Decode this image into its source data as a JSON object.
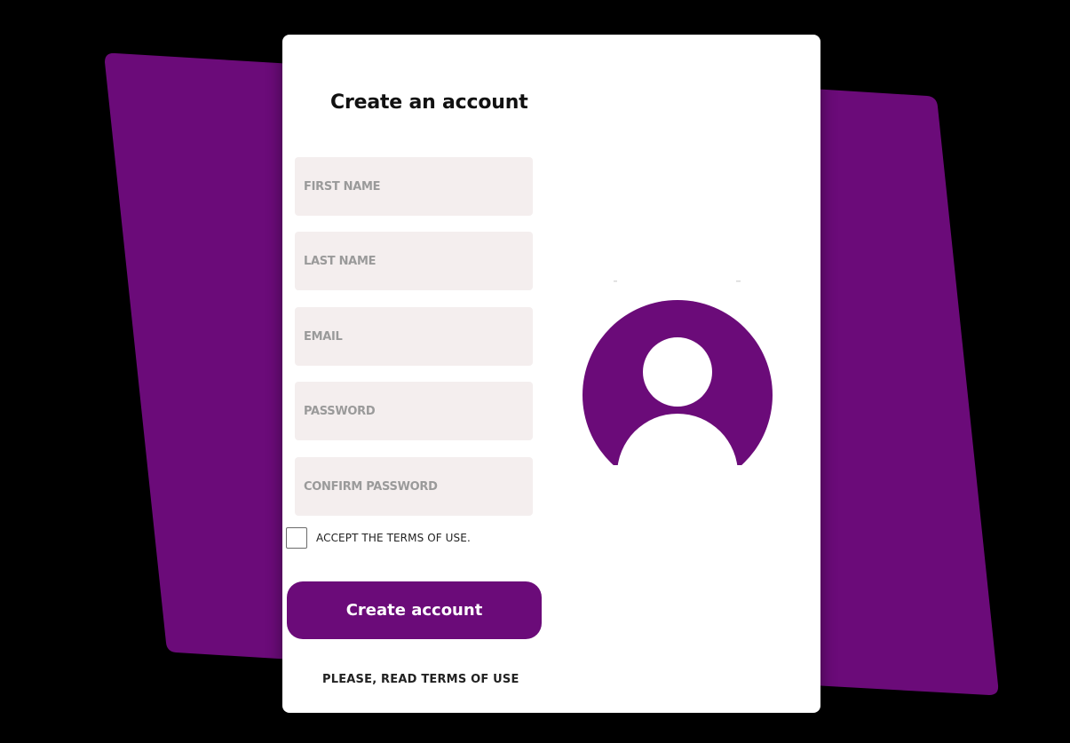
{
  "colors": {
    "background": "#000000",
    "accent": "#6b0b79",
    "card": "#ffffff",
    "field_bg": "#f4eeee",
    "placeholder": "#9a9a9a"
  },
  "form": {
    "title": "Create an account",
    "fields": [
      {
        "name": "first-name",
        "placeholder": "FIRST NAME",
        "value": ""
      },
      {
        "name": "last-name",
        "placeholder": "LAST NAME",
        "value": ""
      },
      {
        "name": "email",
        "placeholder": "EMAIL",
        "value": ""
      },
      {
        "name": "password",
        "placeholder": "PASSWORD",
        "value": ""
      },
      {
        "name": "confirm-password",
        "placeholder": "CONFIRM PASSWORD",
        "value": ""
      }
    ],
    "terms_checkbox": {
      "label": "ACCEPT THE TERMS OF USE.",
      "checked": false
    },
    "submit_label": "Create account",
    "terms_link": "PLEASE, READ TERMS OF USE"
  },
  "avatar": {
    "icon": "user-avatar-icon"
  }
}
